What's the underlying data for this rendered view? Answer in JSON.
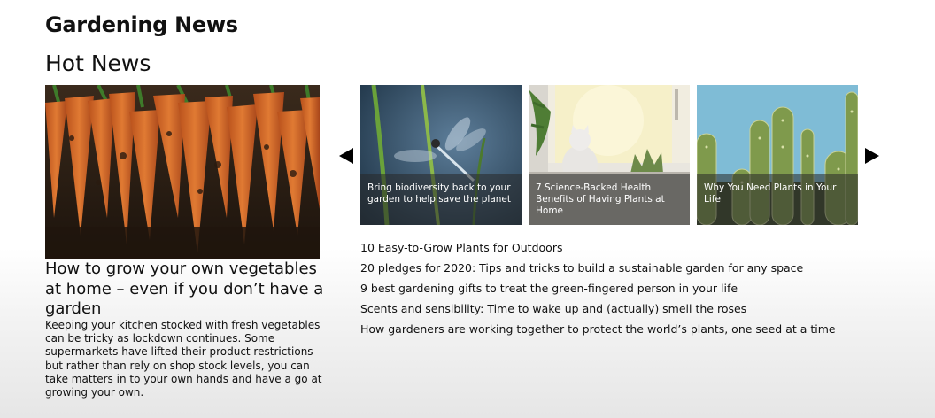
{
  "site": {
    "title": "Gardening News"
  },
  "hot_news": {
    "heading": "Hot News"
  },
  "featured": {
    "image_icon": "carrots-photo",
    "title": "How to grow your own vegetables at home – even if you don’t have a garden",
    "body": "Keeping your kitchen stocked with fresh vegetables can be tricky as lockdown continues. Some supermarkets have lifted their product restrictions but rather than rely on shop stock levels, you can take matters in to your own hands and have a go at growing your own."
  },
  "carousel": {
    "prev_icon": "triangle-left-icon",
    "next_icon": "triangle-right-icon",
    "cards": [
      {
        "caption": "Bring biodiversity back to your garden to help save the planet",
        "image_icon": "dragonfly-photo"
      },
      {
        "caption": "7 Science-Backed Health Benefits of Having Plants at Home",
        "image_icon": "cat-window-photo"
      },
      {
        "caption": "Why You Need Plants in Your Life",
        "image_icon": "cactus-photo"
      }
    ]
  },
  "news_list": [
    "10 Easy-to-Grow Plants for Outdoors",
    "20 pledges for 2020: Tips and tricks to build a sustainable garden for any space",
    "9 best gardening gifts to treat the green-fingered person in your life",
    "Scents and sensibility: Time to wake up and (actually) smell the roses",
    "How gardeners are working together to protect the world’s plants, one seed at a time"
  ],
  "colors": {
    "text": "#111111",
    "caption_overlay": "rgba(40,40,40,0.55)",
    "caption_text": "#ffffff"
  }
}
